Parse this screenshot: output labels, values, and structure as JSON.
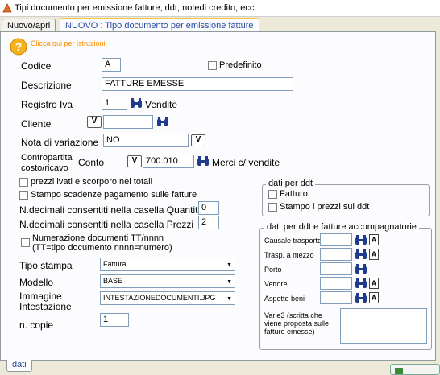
{
  "window": {
    "title": "Tipi documento per emissione fatture, ddt, notedi credito, ecc."
  },
  "tabs": [
    {
      "label": "Nuovo/apri"
    },
    {
      "label": "NUOVO : Tipo documento per emissione fatture"
    }
  ],
  "help": {
    "text": "Clicca qui per istruzioni"
  },
  "form": {
    "codice": {
      "label": "Codice",
      "value": "A"
    },
    "predefinito": {
      "label": "Predefinito",
      "checked": false
    },
    "descrizione": {
      "label": "Descrizione",
      "value": "FATTURE EMESSE"
    },
    "registro_iva": {
      "label": "Registro Iva",
      "value": "1",
      "desc": "Vendite"
    },
    "cliente": {
      "label": "Cliente",
      "btn": "V",
      "value": ""
    },
    "nota_variazione": {
      "label": "Nota di variazione",
      "value": "NO",
      "btn": "V"
    },
    "contropartita": {
      "label_line1": "Contropartita",
      "label_line2": "costo/ricavo",
      "conto_label": "Conto",
      "btn": "V",
      "value": "700.010",
      "desc": "Merci c/ vendite"
    },
    "prezzi_ivati": {
      "label": "prezzi ivati e scorporo nei totali",
      "checked": false
    },
    "stampo_scadenze": {
      "label": "Stampo scadenze pagamento sulle fatture",
      "checked": false
    },
    "decimali_quantita": {
      "label": "N.decimali consentiti nella casella Quantità",
      "value": "0"
    },
    "decimali_prezzi": {
      "label": "N.decimali consentiti nella casella Prezzi",
      "value": "2"
    },
    "numerazione": {
      "label_line1": "Numerazione documenti TT/nnnn",
      "label_line2": "(TT=tipo documento nnnn=numero)",
      "checked": false
    },
    "tipo_stampa": {
      "label": "Tipo stampa",
      "value": "Fattura"
    },
    "modello": {
      "label": "Modello",
      "value": "BASE"
    },
    "immagine": {
      "label_line1": "Immagine",
      "label_line2": "Intestazione",
      "value": "INTESTAZIONEDOCUMENTI.JPG"
    },
    "n_copie": {
      "label": "n. copie",
      "value": "1"
    }
  },
  "ddt_group": {
    "title": "dati per ddt",
    "fatturo": {
      "label": "Fatturo",
      "checked": false
    },
    "stampo_prezzi": {
      "label": "Stampo i prezzi sul ddt",
      "checked": false
    }
  },
  "accomp_group": {
    "title": "dati per ddt e fatture accompagnatorie",
    "causale": {
      "label": "Causale trasporto",
      "value": "",
      "abtn": "A"
    },
    "trasporto": {
      "label": "Trasp. a mezzo",
      "value": "",
      "abtn": "A"
    },
    "porto": {
      "label": "Porto",
      "value": ""
    },
    "vettore": {
      "label": "Vettore",
      "value": "",
      "abtn": "A"
    },
    "aspetto": {
      "label": "Aspetto beni",
      "value": "",
      "abtn": "A"
    },
    "varie3": {
      "label": "Varie3 (scritta che viene proposta sulle fatture emesse)",
      "value": ""
    }
  },
  "bottom_tabs": [
    {
      "label": "dati"
    }
  ],
  "colors": {
    "tab_active_border": "#ffc83c",
    "help_text": "#ff8c00",
    "panel_bg": "#fcfcfe",
    "window_bg": "#ece9d8"
  }
}
